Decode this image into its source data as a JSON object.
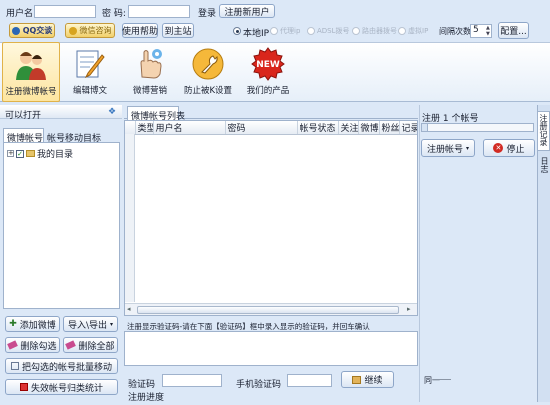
{
  "top": {
    "username_label": "用户名:",
    "password_label": "密  码:",
    "login_label": "登录",
    "register_label": "注册新用户"
  },
  "toolbar2": {
    "qq_label": "QQ交谈",
    "consult_label": "微信咨询",
    "help_label": "使用帮助",
    "home_label": "到主站",
    "radio_local": "本地IP",
    "radio_options": [
      "代理ip",
      "ADSL拨号",
      "路由器拨号",
      "虚拟IP"
    ],
    "interval_label": "间隔次数",
    "interval_value": "5",
    "config_label": "配置..."
  },
  "big_toolbar": [
    {
      "label": "注册微博帐号",
      "icon": "user-icon"
    },
    {
      "label": "编辑博文",
      "icon": "edit-icon"
    },
    {
      "label": "微博营销",
      "icon": "hand-icon"
    },
    {
      "label": "防止被K设置",
      "icon": "wrench-icon"
    },
    {
      "label": "我们的产品",
      "icon": "new-badge-icon"
    }
  ],
  "left": {
    "title": "可以打开",
    "tab1": "微博帐号",
    "tab2": "帐号移动目标",
    "tree_item": "我的目录",
    "btn_add": "添加微博",
    "btn_import": "导入\\导出",
    "btn_del_checked": "删除勾选",
    "btn_del_all": "删除全部",
    "btn_batch_move": "把勾选的帐号批量移动",
    "btn_invalid": "失效帐号归类统计"
  },
  "center": {
    "tab": "微博帐号列表",
    "columns": [
      "类型",
      "用户名",
      "密码",
      "帐号状态",
      "关注",
      "微博",
      "粉丝",
      "记录"
    ],
    "captcha_hint": "注册显示验证码-请在下面【验证码】框中录入显示的验证码，并回车确认",
    "captcha_label": "验证码",
    "phone_captcha_label": "手机验证码",
    "continue_label": "继续",
    "progress_label": "注册进度"
  },
  "right": {
    "register_count": "注册 1 个帐号",
    "register_btn": "注册帐号",
    "stop_btn": "停止",
    "bottom_label": "同一"
  },
  "right_tabs": [
    "注册记录",
    "日志"
  ]
}
